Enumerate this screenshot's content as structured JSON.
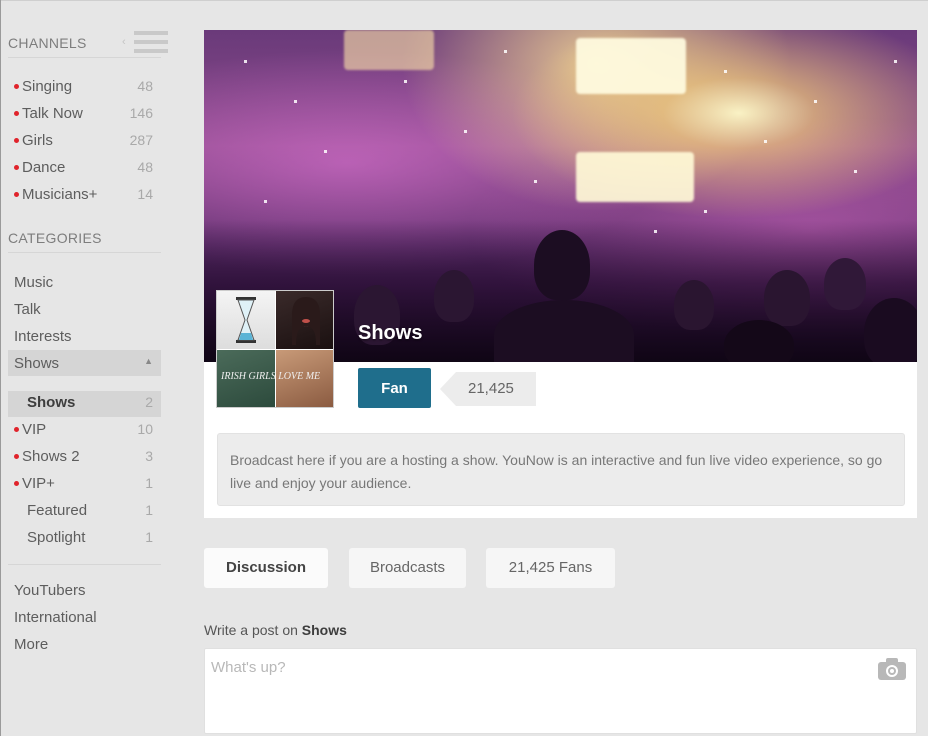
{
  "sidebar": {
    "channels_heading": "CHANNELS",
    "channels": [
      {
        "label": "Singing",
        "count": "48"
      },
      {
        "label": "Talk Now",
        "count": "146"
      },
      {
        "label": "Girls",
        "count": "287"
      },
      {
        "label": "Dance",
        "count": "48"
      },
      {
        "label": "Musicians+",
        "count": "14"
      }
    ],
    "categories_heading": "CATEGORIES",
    "categories": [
      {
        "label": "Music"
      },
      {
        "label": "Talk"
      },
      {
        "label": "Interests"
      },
      {
        "label": "Shows"
      }
    ],
    "shows_sub": [
      {
        "label": "Shows",
        "count": "2"
      },
      {
        "label": "VIP",
        "count": "10"
      },
      {
        "label": "Shows 2",
        "count": "3"
      },
      {
        "label": "VIP+",
        "count": "1"
      },
      {
        "label": "Featured",
        "count": "1"
      },
      {
        "label": "Spotlight",
        "count": "1"
      }
    ],
    "more_links": [
      {
        "label": "YouTubers"
      },
      {
        "label": "International"
      },
      {
        "label": "More"
      }
    ]
  },
  "profile": {
    "title": "Shows",
    "avatar_text": "IRISH GIRLS LOVE ME",
    "fan_button_label": "Fan",
    "fan_count": "21,425",
    "description": "Broadcast here if you are a hosting a show. YouNow is an interactive and fun live video experience, so go live and enjoy your audience."
  },
  "tabs": [
    {
      "label": "Discussion"
    },
    {
      "label": "Broadcasts"
    },
    {
      "label": "21,425 Fans"
    }
  ],
  "post": {
    "prompt_prefix": "Write a post on ",
    "prompt_target": "Shows",
    "placeholder": "What's up?"
  },
  "colors": {
    "accent_fan_button": "#1f6e8c",
    "live_dot": "#e0232b",
    "background": "#e6e6e6"
  },
  "icons": {
    "menu": "hamburger-icon",
    "collapse": "chevron-up-icon",
    "camera": "camera-icon"
  }
}
